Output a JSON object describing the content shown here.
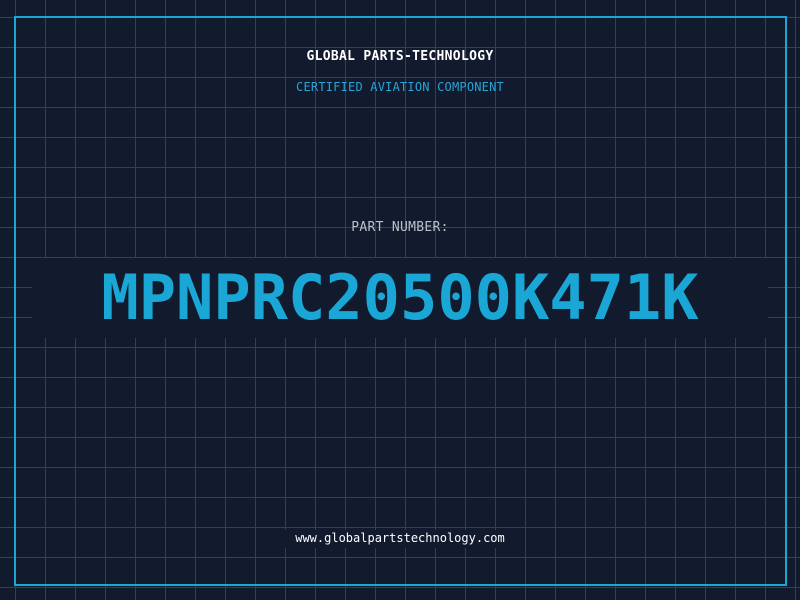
{
  "header": {
    "company": "GLOBAL PARTS-TECHNOLOGY",
    "subtitle": "CERTIFIED AVIATION COMPONENT"
  },
  "part": {
    "label": "PART NUMBER:",
    "number": "MPNPRC20500K471K"
  },
  "footer": {
    "url": "www.globalpartstechnology.com"
  },
  "colors": {
    "background": "#121a2e",
    "grid": "#1f4a5c",
    "accent": "#1ba7d6",
    "title_text": "#ffffff",
    "label_text": "#b9c0c8"
  }
}
